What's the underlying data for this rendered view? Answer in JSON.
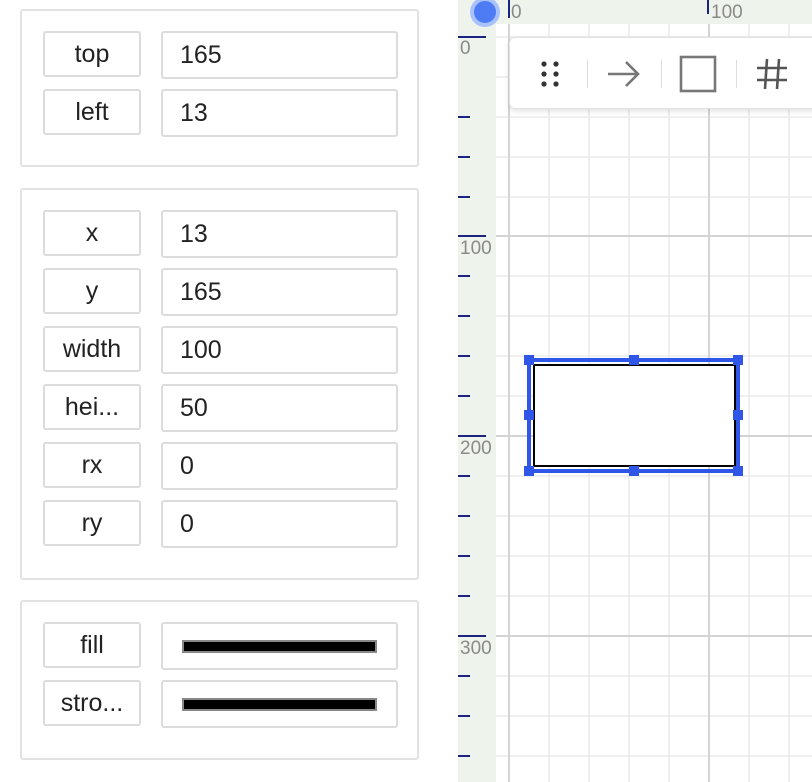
{
  "position_panel": {
    "rows": [
      {
        "label": "top",
        "value": "165"
      },
      {
        "label": "left",
        "value": "13"
      }
    ]
  },
  "geometry_panel": {
    "rows": [
      {
        "label": "x",
        "value": "13"
      },
      {
        "label": "y",
        "value": "165"
      },
      {
        "label": "width",
        "value": "100"
      },
      {
        "label": "hei...",
        "value": "50"
      },
      {
        "label": "rx",
        "value": "0"
      },
      {
        "label": "ry",
        "value": "0"
      }
    ]
  },
  "style_panel": {
    "rows": [
      {
        "label": "fill",
        "color": "#000000"
      },
      {
        "label": "stro...",
        "color": "#000000"
      }
    ]
  },
  "ruler": {
    "top_labels": [
      "0",
      "100"
    ],
    "left_labels": [
      "0",
      "100",
      "200",
      "300"
    ]
  },
  "toolbar": {
    "icons": [
      "drag-handle-icon",
      "arrow-right-icon",
      "rectangle-icon",
      "grid-icon"
    ]
  },
  "colors": {
    "selection": "#3056e8",
    "ruler_bg": "#eef3ec",
    "grid_line": "#e4e4e4",
    "ruler_major_tick": "#1a237e"
  }
}
